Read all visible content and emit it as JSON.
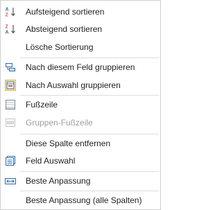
{
  "menu": {
    "items": [
      {
        "label": "Aufsteigend sortieren",
        "icon": "sort-ascending-icon"
      },
      {
        "label": "Absteigend sortieren",
        "icon": "sort-descending-icon"
      },
      {
        "label": "Lösche Sortierung"
      },
      {
        "label": "Nach diesem Feld gruppieren",
        "icon": "group-by-field-icon"
      },
      {
        "label": "Nach Auswahl gruppieren",
        "icon": "group-by-selection-icon"
      },
      {
        "label": "Fußzeile",
        "icon": "footer-icon"
      },
      {
        "label": "Gruppen-Fußzeile",
        "icon": "group-footer-icon",
        "disabled": true
      },
      {
        "label": "Diese Spalte entfernen"
      },
      {
        "label": "Feld Auswahl",
        "icon": "field-chooser-icon"
      },
      {
        "label": "Beste Anpassung",
        "icon": "best-fit-icon"
      },
      {
        "label": "Beste Anpassung (alle Spalten)"
      }
    ]
  },
  "colors": {
    "icon_blue": "#2b6cb0",
    "icon_red": "#d9534f",
    "disabled_text": "#9e9e9e",
    "separator": "#dedede",
    "selected_icon_bg": "#fde9a8",
    "selected_icon_border": "#e0b34c"
  }
}
